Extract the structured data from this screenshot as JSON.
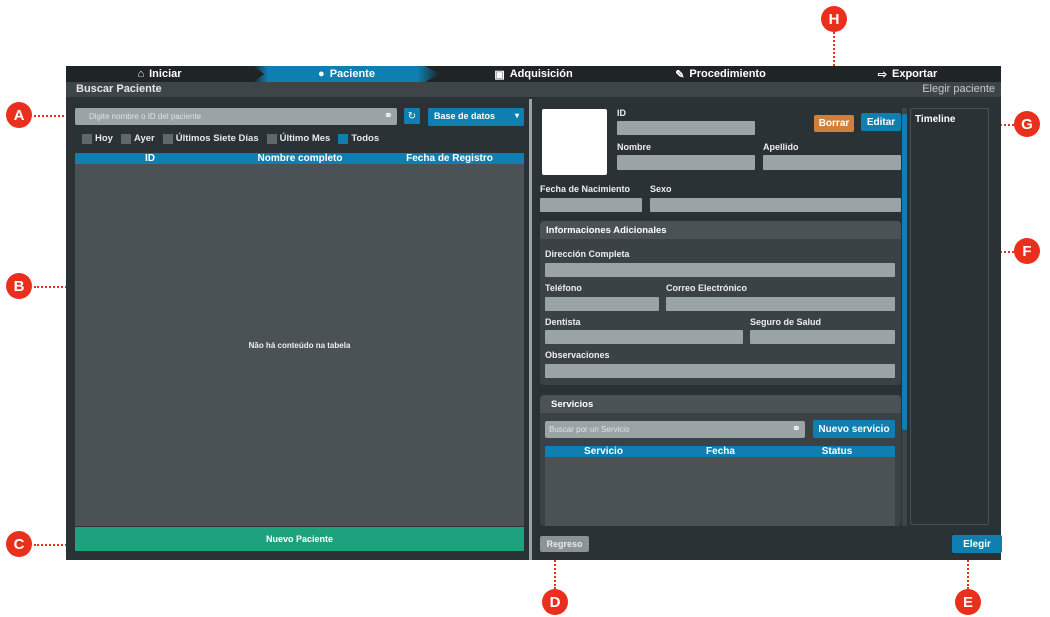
{
  "callouts": [
    "A",
    "B",
    "C",
    "D",
    "E",
    "F",
    "G",
    "H"
  ],
  "nav": [
    {
      "label": "Iniciar",
      "icon": "home-icon"
    },
    {
      "label": "Paciente",
      "icon": "user-icon"
    },
    {
      "label": "Adquisición",
      "icon": "camera-icon"
    },
    {
      "label": "Procedimiento",
      "icon": "edit-icon"
    },
    {
      "label": "Exportar",
      "icon": "export-icon"
    }
  ],
  "titlebar": {
    "left": "Buscar Paciente",
    "right": "Elegir paciente"
  },
  "search": {
    "placeholder": "Digite nombre o ID del paciente"
  },
  "source_select": {
    "value": "Base de datos"
  },
  "filters": [
    {
      "label": "Hoy",
      "checked": false
    },
    {
      "label": "Ayer",
      "checked": false
    },
    {
      "label": "Últimos Siete Días",
      "checked": false
    },
    {
      "label": "Último Mes",
      "checked": false
    },
    {
      "label": "Todos",
      "checked": true
    }
  ],
  "patients_table": {
    "columns": [
      "ID",
      "Nombre completo",
      "Fecha de Registro"
    ],
    "empty_text": "Não há conteúdo na tabela"
  },
  "new_patient_label": "Nuevo Paciente",
  "patient_form": {
    "id_label": "ID",
    "name_label": "Nombre",
    "surname_label": "Apellido",
    "birth_label": "Fecha de Nacimiento",
    "sex_label": "Sexo"
  },
  "buttons": {
    "delete": "Borrar",
    "edit": "Editar",
    "back": "Regreso",
    "choose": "Elegir",
    "new_service": "Nuevo servicio"
  },
  "timeline_label": "Timeline",
  "additional_info": {
    "title": "Informaciones Adicionales",
    "address_label": "Dirección Completa",
    "phone_label": "Teléfono",
    "email_label": "Correo Electrónico",
    "dentist_label": "Dentista",
    "insurance_label": "Seguro de Salud",
    "notes_label": "Observaciones"
  },
  "services": {
    "title": "Servicios",
    "search_placeholder": "Buscar por un Servicio",
    "columns": [
      "Servicio",
      "Fecha",
      "Status"
    ]
  },
  "colors": {
    "accent": "#0f7fb1",
    "green": "#1ea27e",
    "orange": "#d0803a",
    "marker": "#e8301c"
  }
}
